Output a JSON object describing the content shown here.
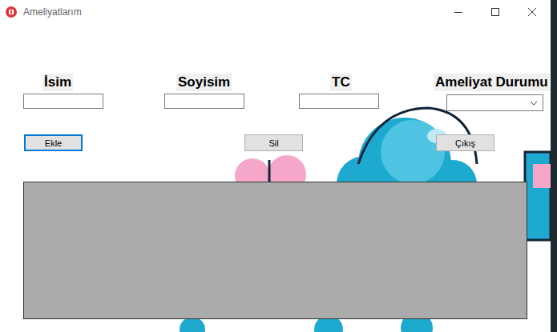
{
  "window": {
    "title": "Ameliyatlarım"
  },
  "fields": [
    {
      "label": "İsim",
      "kind": "text",
      "value": ""
    },
    {
      "label": "Soyisim",
      "kind": "text",
      "value": ""
    },
    {
      "label": "TC",
      "kind": "text",
      "value": ""
    },
    {
      "label": "Ameliyat Durumu",
      "kind": "dropdown",
      "value": ""
    }
  ],
  "buttons": [
    {
      "label": "Ekle",
      "focused": true
    },
    {
      "label": "Sil",
      "focused": false
    },
    {
      "label": "Çıkış",
      "focused": false
    }
  ],
  "grid": {
    "rows": []
  }
}
